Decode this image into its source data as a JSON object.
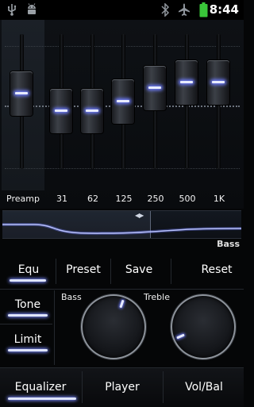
{
  "status_bar": {
    "time": "8:44",
    "icons": [
      "usb-icon",
      "android-debug-icon",
      "bluetooth-icon",
      "airplane-mode-icon",
      "battery-icon"
    ],
    "battery_color": "#39c639"
  },
  "equalizer": {
    "bands": [
      {
        "label": "Preamp",
        "level": 0.56
      },
      {
        "label": "31",
        "level": 0.43
      },
      {
        "label": "62",
        "level": 0.43
      },
      {
        "label": "125",
        "level": 0.5
      },
      {
        "label": "250",
        "level": 0.6
      },
      {
        "label": "500",
        "level": 0.64
      },
      {
        "label": "1K",
        "level": 0.64
      }
    ],
    "curve_label": "Bass"
  },
  "controls": {
    "equ": "Equ",
    "preset": "Preset",
    "save": "Save",
    "reset": "Reset",
    "tone": "Tone",
    "limit": "Limit",
    "bass_label": "Bass",
    "treble_label": "Treble",
    "bass_knob_level": 0.57,
    "treble_knob_level": 0.08
  },
  "bottom_tabs": {
    "equalizer": "Equalizer",
    "player": "Player",
    "vol_bal": "Vol/Bal"
  },
  "colors": {
    "accent_glow": "#6f7dff",
    "background": "#050607"
  }
}
